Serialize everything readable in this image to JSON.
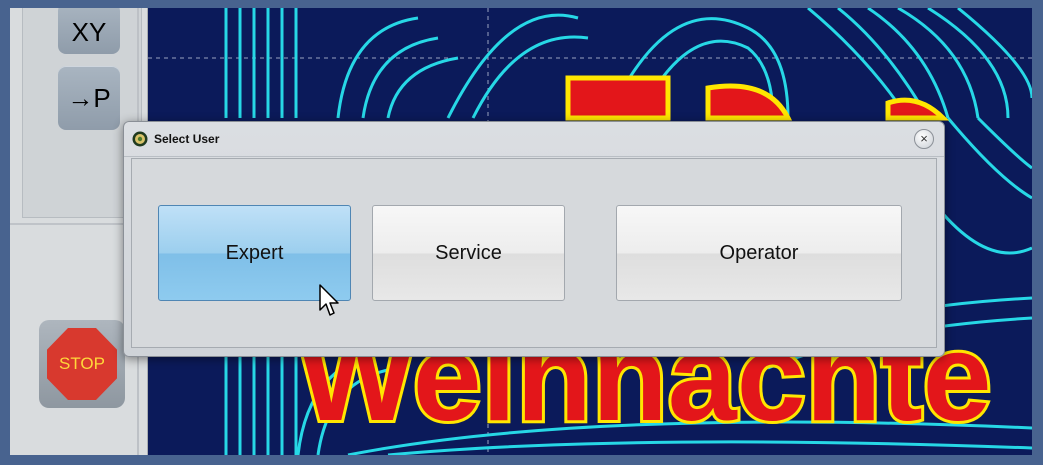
{
  "toolbar": {
    "xy_label": "XY",
    "to_p_label": "→P",
    "stop_label": "STOP"
  },
  "dialog": {
    "title": "Select User",
    "close_glyph": "×",
    "buttons": [
      {
        "label": "Expert",
        "state": "hovered"
      },
      {
        "label": "Service"
      },
      {
        "label": "Operator"
      }
    ]
  },
  "drawing": {
    "text": "Weihnachte",
    "colors": {
      "background": "#0b1a5a",
      "toolpath": "#27d8e6",
      "outline": "#ffe600",
      "fill": "#e3161a"
    }
  },
  "icons": {
    "app": "settings-gear-icon",
    "close": "close-icon",
    "cursor": "mouse-cursor-icon"
  }
}
